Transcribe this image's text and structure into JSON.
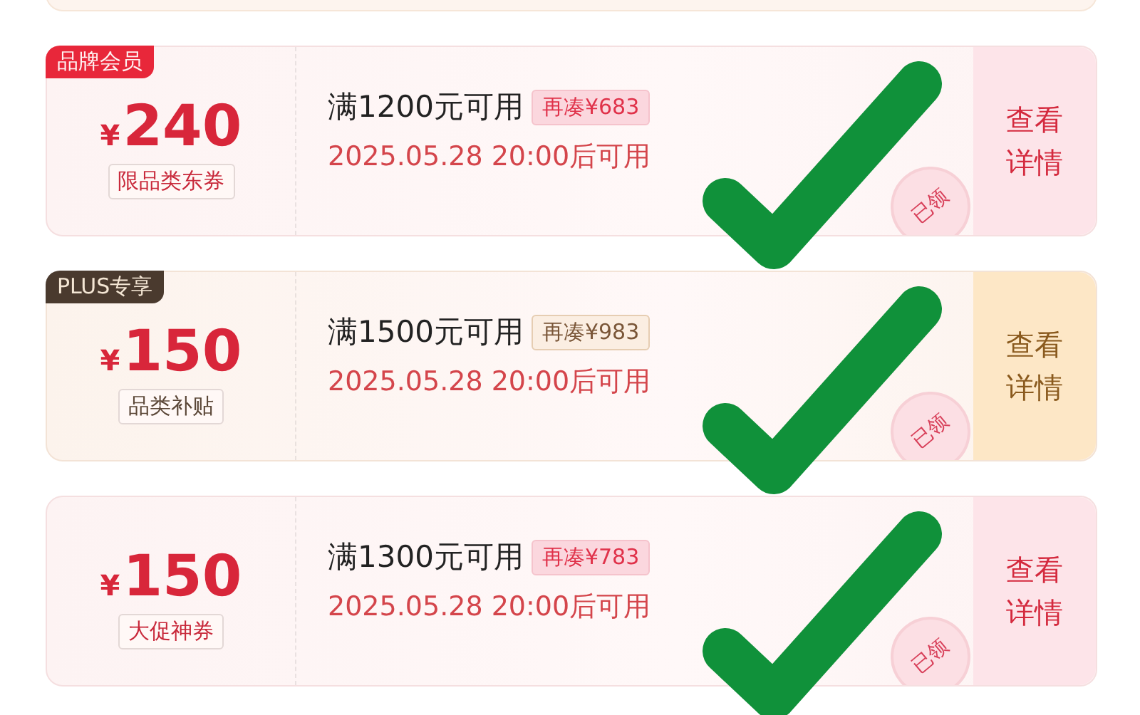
{
  "coupons": [
    {
      "kind": "brand",
      "badge": "品牌会员",
      "currency": "¥",
      "amount": "240",
      "scope": "限品类东券",
      "condition": "满1200元可用",
      "gap": "再凑¥683",
      "valid_from": "2025.05.28 20:00后可用",
      "action": "查看详情",
      "stamp": "已领",
      "checked": true
    },
    {
      "kind": "plus",
      "badge": "PLUS专享",
      "currency": "¥",
      "amount": "150",
      "scope": "品类补贴",
      "condition": "满1500元可用",
      "gap": "再凑¥983",
      "valid_from": "2025.05.28 20:00后可用",
      "action": "查看详情",
      "stamp": "已领",
      "checked": true
    },
    {
      "kind": "brand",
      "currency": "¥",
      "amount": "150",
      "scope": "大促神券",
      "condition": "满1300元可用",
      "gap": "再凑¥783",
      "valid_from": "2025.05.28 20:00后可用",
      "action": "查看详情",
      "stamp": "已领",
      "checked": true
    }
  ]
}
